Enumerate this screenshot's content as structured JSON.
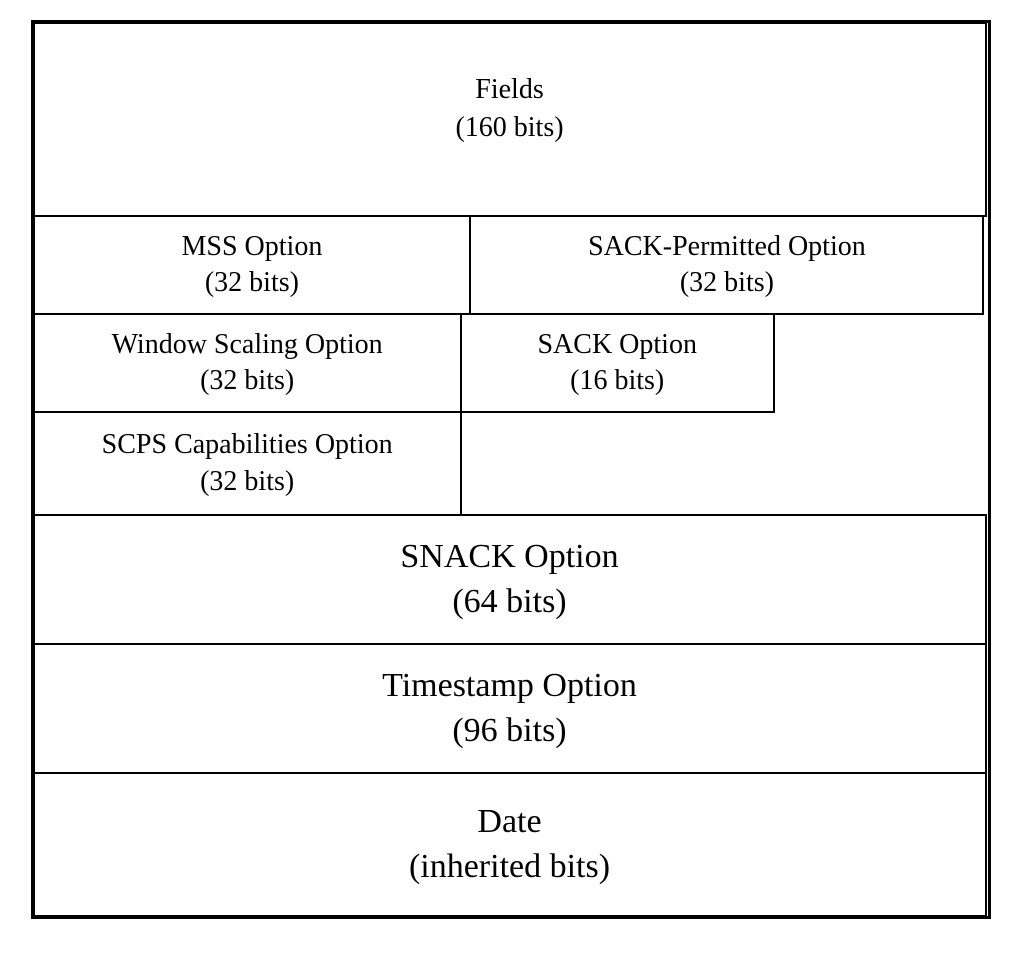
{
  "fields": {
    "name": "Fields",
    "bits": "(160 bits)"
  },
  "mss": {
    "name": "MSS Option",
    "bits": "(32 bits)"
  },
  "sack_permitted": {
    "name": "SACK-Permitted Option",
    "bits": "(32 bits)"
  },
  "window_scaling": {
    "name": "Window Scaling Option",
    "bits": "(32 bits)"
  },
  "sack_option": {
    "name": "SACK Option",
    "bits": "(16 bits)"
  },
  "scps": {
    "name": "SCPS Capabilities Option",
    "bits": "(32 bits)"
  },
  "snack": {
    "name": "SNACK Option",
    "bits": "(64 bits)"
  },
  "timestamp": {
    "name": "Timestamp Option",
    "bits": "(96 bits)"
  },
  "date": {
    "name": "Date",
    "bits": "(inherited bits)"
  }
}
